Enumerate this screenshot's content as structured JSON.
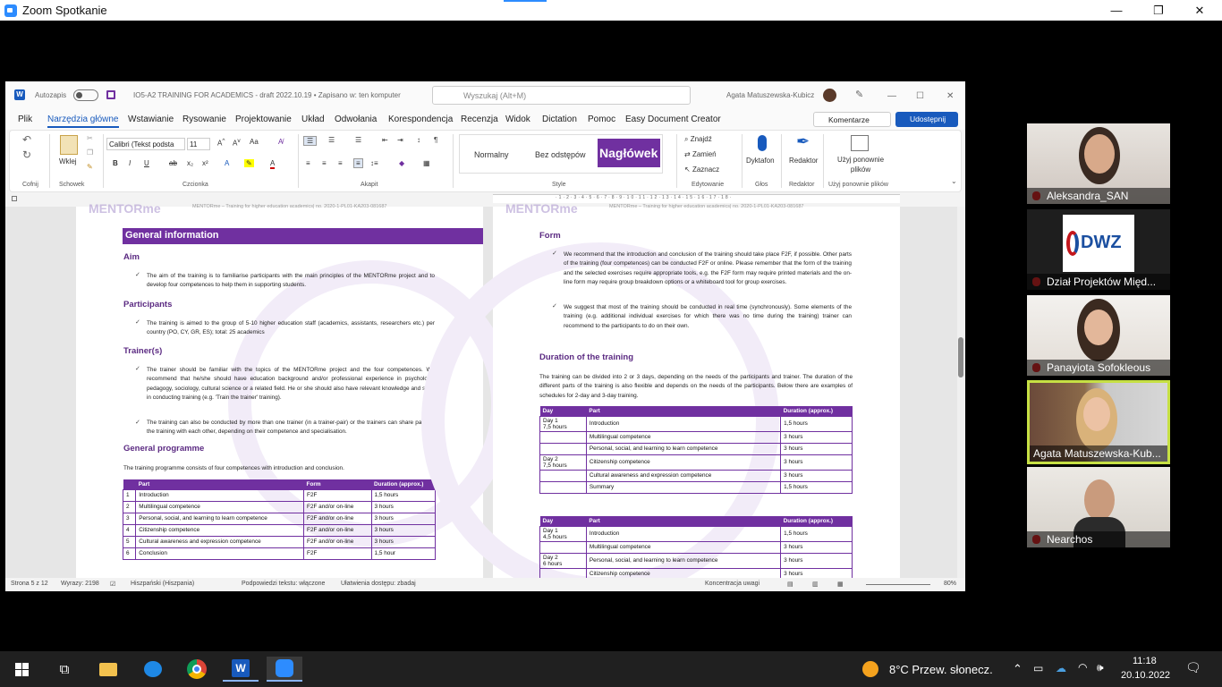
{
  "zoom": {
    "title": "Zoom Spotkanie",
    "min": "—",
    "max": "❐",
    "close": "✕"
  },
  "word": {
    "autosave": "Autozapis",
    "doc_title": "IO5-A2 TRAINING FOR ACADEMICS - draft 2022.10.19 • Zapisano w: ten komputer",
    "search_placeholder": "Wyszukaj (Alt+M)",
    "user": "Agata Matuszewska-Kubicz",
    "menu": [
      "Plik",
      "Narzędzia główne",
      "Wstawianie",
      "Rysowanie",
      "Projektowanie",
      "Układ",
      "Odwołania",
      "Korespondencja",
      "Recenzja",
      "Widok",
      "Dictation",
      "Pomoc",
      "Easy Document Creator"
    ],
    "comments": "Komentarze",
    "share": "Udostępnij",
    "ribbon": {
      "undo": "Cofnij",
      "clipboard": "Schowek",
      "paste": "Wklej",
      "font_group": "Czcionka",
      "font_name": "Calibri (Tekst podsta",
      "font_size": "11",
      "paragraph": "Akapit",
      "styles": "Style",
      "style_normal": "Normalny",
      "style_nospace": "Bez odstępów",
      "style_heading": "Nagłówek",
      "find": "Znajdź",
      "replace": "Zamień",
      "select": "Zaznacz",
      "editing": "Edytowanie",
      "dictate": "Dyktafon",
      "voice": "Głos",
      "editor": "Redaktor",
      "editor_group": "Redaktor",
      "reuse": "Użyj ponownie plików",
      "reuse_group": "Użyj ponownie plików"
    },
    "status": {
      "page": "Strona 5 z 12",
      "words": "Wyrazy: 2198",
      "lang": "Hiszpański (Hiszpania)",
      "predict": "Podpowiedzi tekstu: włączone",
      "access": "Ułatwienia dostępu: zbadaj",
      "focus": "Koncentracja uwagi",
      "zoom": "80%"
    }
  },
  "doc": {
    "header_left": "MENTORme – Training for higher education academics| no. 2020-1-PL01-KA203-081687",
    "header_right": "MENTORme – Training for higher education academics| no. 2020-1-PL01-KA203-081687",
    "logo": "MENTORme",
    "general_info": "General information",
    "aim": "Aim",
    "aim_text": "The aim of the training is to familiarise participants with the main principles of the MENTORme project and to develop four competences to help them in supporting students.",
    "participants": "Participants",
    "participants_text": "The training is aimed to the group of 5-10 higher education staff (academics, assistants, researchers etc.) per country (PO, CY, GR, ES); total: 25 academics",
    "trainers": "Trainer(s)",
    "trainers_text1": "The trainer should be familiar with the topics of the MENTORme project and the four competences. We recommend that he/she should have education background and/or professional experience in psychology, pedagogy, sociology, cultural science or a related field. He or she should also have relevant knowledge and skills in conducting training (e.g. 'Train the trainer' training).",
    "trainers_text2": "The training can also be conducted by more than one trainer (in a trainer-pair) or the trainers can share parts of the training with each other, depending on their competence and specialisation.",
    "general_programme": "General programme",
    "programme_text": "The training programme consists of four competences with introduction and conclusion.",
    "table1": {
      "headers": [
        "",
        "Part",
        "Form",
        "Duration (approx.)"
      ],
      "rows": [
        [
          "1",
          "Introduction",
          "F2F",
          "1,5 hours"
        ],
        [
          "2",
          "Multilingual competence",
          "F2F and/or on-line",
          "3 hours"
        ],
        [
          "3",
          "Personal, social, and learning to learn competence",
          "F2F and/or on-line",
          "3 hours"
        ],
        [
          "4",
          "Citizenship competence",
          "F2F and/or on-line",
          "3 hours"
        ],
        [
          "5",
          "Cultural awareness and expression competence",
          "F2F and/or on-line",
          "3 hours"
        ],
        [
          "6",
          "Conclusion",
          "F2F",
          "1,5 hour"
        ]
      ]
    },
    "form": "Form",
    "form_text1": "We recommend that the introduction and conclusion of the training should take place F2F, if possible. Other parts of the training (four competences) can be conducted F2F or online. Please remember that the form of the training and the selected exercises require appropriate tools, e.g. the F2F form may require printed materials and the on-line form may require group breakdown options or a whiteboard tool for group exercises.",
    "form_text2": "We suggest that most of the training should be conducted in real time (synchronously). Some elements of the training (e.g. additional individual exercises for which there was no time during the training) trainer can recommend to the participants to do on their own.",
    "duration": "Duration of the training",
    "duration_text": "The training can be divided into 2 or 3 days, depending on the needs of the participants and trainer. The duration of the different parts of the training is also flexible and depends on the needs of the participants. Below there are examples of schedules for 2-day and 3-day training.",
    "table2": {
      "headers": [
        "Day",
        "Part",
        "Duration (approx.)"
      ],
      "rows": [
        [
          "Day 1\n7,5 hours",
          "Introduction",
          "1,5 hours"
        ],
        [
          "",
          "Multilingual competence",
          "3 hours"
        ],
        [
          "",
          "Personal, social, and learning to learn competence",
          "3 hours"
        ],
        [
          "Day 2\n7,5 hours",
          "Citizenship competence",
          "3 hours"
        ],
        [
          "",
          "Cultural awareness and expression competence",
          "3 hours"
        ],
        [
          "",
          "Summary",
          "1,5 hours"
        ]
      ]
    },
    "table3": {
      "headers": [
        "Day",
        "Part",
        "Duration (approx.)"
      ],
      "rows": [
        [
          "Day 1\n4,5 hours",
          "Introduction",
          "1,5 hours"
        ],
        [
          "",
          "Multilingual competence",
          "3 hours"
        ],
        [
          "Day 2\n6 hours",
          "Personal, social, and learning to learn competence",
          "3 hours"
        ],
        [
          "",
          "Citizenship competence",
          "3 hours"
        ]
      ]
    }
  },
  "participants": [
    "Aleksandra_SAN",
    "Dział Projektów Międ...",
    "Panayiota Sofokleous",
    "Agata Matuszewska-Kub...",
    "Nearchos"
  ],
  "dwz_logo": "DWZ",
  "taskbar": {
    "weather": "8°C  Przew. słonecz.",
    "time": "11:18",
    "date": "20.10.2022"
  },
  "colors": {
    "accent": "#7030a0",
    "word_blue": "#185abd",
    "active_speaker": "#c6e044"
  }
}
